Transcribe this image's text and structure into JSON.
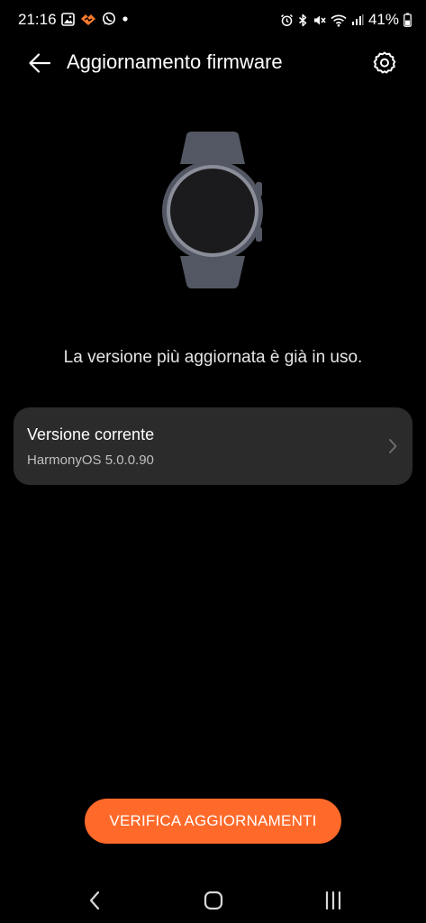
{
  "status_bar": {
    "time": "21:16",
    "battery": "41%",
    "left_icons": [
      "gallery-icon",
      "app-notification-icon",
      "whatsapp-icon",
      "dot-icon"
    ],
    "right_icons": [
      "alarm-icon",
      "bluetooth-icon",
      "mute-icon",
      "wifi-icon",
      "signal-icon",
      "battery-icon"
    ]
  },
  "header": {
    "title": "Aggiornamento firmware",
    "back_icon": "arrow-left-icon",
    "settings_icon": "gear-icon"
  },
  "illustration": {
    "icon": "smartwatch-icon",
    "body_color": "#535764",
    "bezel_color": "#8b8e99",
    "face_color": "#1b1b1d"
  },
  "main": {
    "status_message": "La versione più aggiornata è già in uso.",
    "version_card": {
      "label": "Versione corrente",
      "value": "HarmonyOS 5.0.0.90"
    },
    "check_button_label": "VERIFICA AGGIORNAMENTI"
  },
  "nav_bar": {
    "items": [
      "back-icon",
      "home-icon",
      "recents-icon"
    ]
  },
  "colors": {
    "background": "#000000",
    "card": "#2b2b2b",
    "accent": "#ff6a2a",
    "text_primary": "#ffffff",
    "text_secondary": "#bfbfbf"
  }
}
